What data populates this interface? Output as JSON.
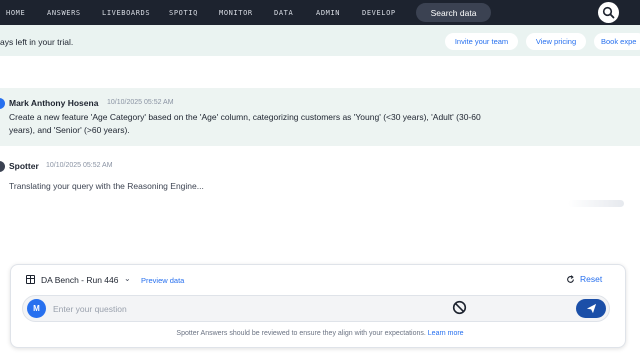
{
  "nav": {
    "items": [
      "HOME",
      "ANSWERS",
      "LIVEBOARDS",
      "SPOTIQ",
      "MONITOR",
      "DATA",
      "ADMIN",
      "DEVELOP"
    ],
    "search_label": "Search data"
  },
  "trial": {
    "text": "ays left in your trial.",
    "invite_label": "Invite your team",
    "pricing_label": "View pricing",
    "book_label": "Book expe"
  },
  "messages": {
    "user": {
      "name": "Mark Anthony Hosena",
      "time": "10/10/2025 05:52 AM",
      "line1": "Create a new feature 'Age Category' based on the 'Age' column, categorizing customers as 'Young' (<30 years), 'Adult' (30-60",
      "line2": "years), and 'Senior' (>60 years)."
    },
    "spotter": {
      "name": "Spotter",
      "time": "10/10/2025 05:52 AM",
      "text": "Translating your query with the Reasoning Engine..."
    }
  },
  "composer": {
    "datasource_label": "DA Bench - Run 446",
    "preview_label": "Preview data",
    "reset_label": "Reset",
    "avatar_initial": "M",
    "placeholder": "Enter your question",
    "disclaimer": "Spotter Answers should be reviewed to ensure they align with your expectations.",
    "learn_more": "Learn more"
  },
  "colors": {
    "nav_bg": "#1d232f",
    "accent": "#2770ef",
    "send_bg": "#1b4fa8",
    "user_dot": "#2770ef",
    "spotter_dot": "#3b4252"
  }
}
